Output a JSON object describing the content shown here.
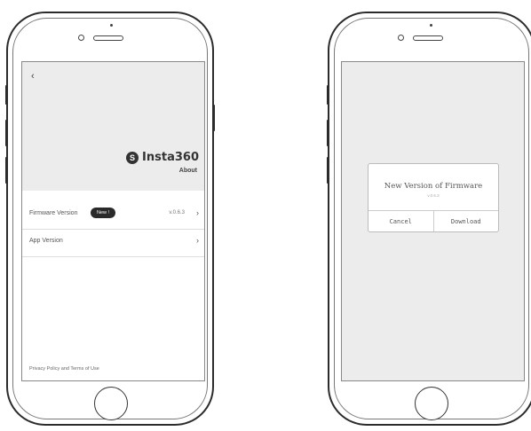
{
  "screen_about": {
    "back_icon": "‹",
    "logo_glyph": "S",
    "brand": "Insta360",
    "page_title": "About",
    "firmware": {
      "label": "Firmware Version",
      "badge": "New !",
      "value": "v.0.6.3",
      "chevron": "›"
    },
    "app_version": {
      "label": "App Version",
      "chevron": "›"
    },
    "footer_link": "Privacy Policy and Terms of Use"
  },
  "screen_dialog": {
    "title": "New Version of Firmware",
    "subtitle": "v.0.6.3",
    "cancel": "Cancel",
    "download": "Download"
  }
}
